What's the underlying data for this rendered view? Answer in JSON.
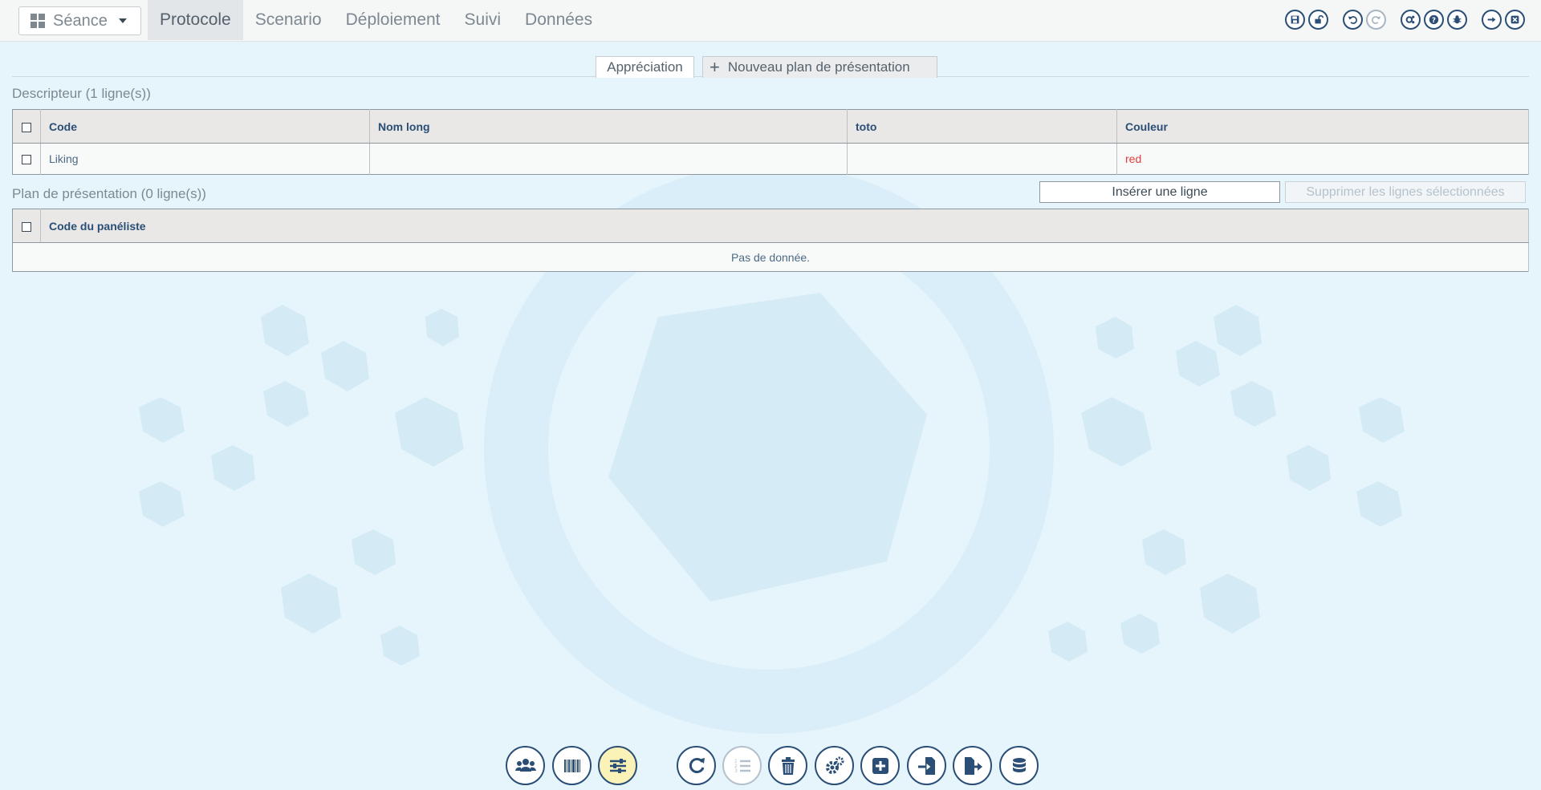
{
  "topbar": {
    "seance_label": "Séance",
    "nav": [
      "Protocole",
      "Scenario",
      "Déploiement",
      "Suivi",
      "Données"
    ],
    "active_nav": "Protocole",
    "tool_icons": [
      "save-icon",
      "unlock-icon",
      "undo-icon",
      "redo-icon",
      "settings-share-icon",
      "help-icon",
      "bug-icon",
      "sign-out-icon",
      "close-window-icon"
    ]
  },
  "tabs": {
    "appreciation": "Appréciation",
    "new_plan": "Nouveau plan de présentation"
  },
  "descripteur": {
    "title": "Descripteur (1 ligne(s))",
    "columns": [
      "Code",
      "Nom long",
      "toto",
      "Couleur"
    ],
    "rows": [
      {
        "code": "Liking",
        "nom_long": "",
        "toto": "",
        "couleur": "red"
      }
    ]
  },
  "plan": {
    "title": "Plan de présentation (0 ligne(s))",
    "insert_label": "Insérer une ligne",
    "delete_label": "Supprimer les lignes sélectionnées",
    "columns": [
      "Code du panéliste"
    ],
    "empty_text": "Pas de donnée."
  },
  "bottom_toolbar": [
    "users-icon",
    "barcode-icon",
    "sliders-icon",
    "refresh-icon",
    "numbered-list-icon",
    "trash-icon",
    "cogs-icon",
    "plus-square-icon",
    "import-icon",
    "export-icon",
    "database-icon"
  ],
  "colors": {
    "accent": "#2a4e75",
    "background": "#e6f5fc",
    "active_button": "#fbf2b8",
    "red_value": "#e33b3b"
  }
}
